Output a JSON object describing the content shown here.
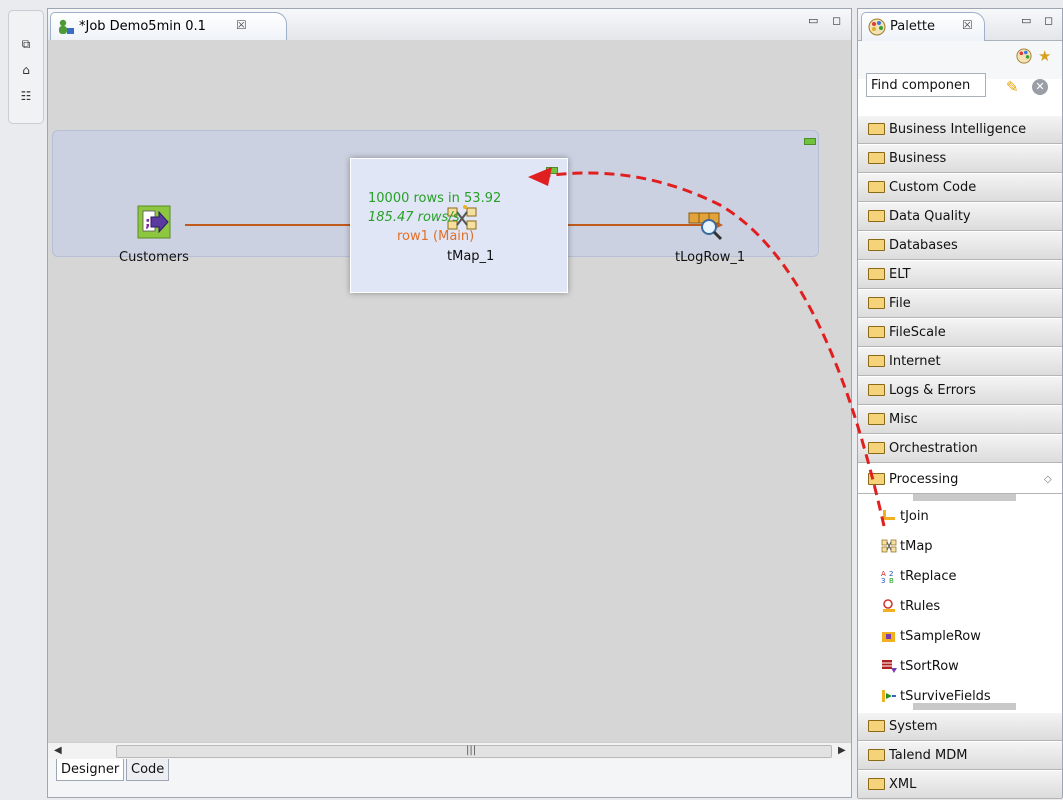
{
  "editor": {
    "tab_title": "*Job Demo5min 0.1",
    "tab_close": "☒"
  },
  "bottom_tabs": [
    "Designer",
    "Code"
  ],
  "canvas": {
    "components": {
      "customers": "Customers",
      "tmap": "tMap_1",
      "logrow": "tLogRow_1"
    },
    "flow_stats": {
      "rows": "10000 rows in 53.92",
      "rate": "185.47 rows/s",
      "link": "row1 (Main)"
    }
  },
  "palette": {
    "tab_title": "Palette",
    "tab_close": "☒",
    "find_placeholder": "Find componen",
    "categories_before": [
      "Business Intelligence",
      "Business",
      "Custom Code",
      "Data Quality",
      "Databases",
      "ELT",
      "File",
      "FileScale",
      "Internet",
      "Logs & Errors",
      "Misc",
      "Orchestration"
    ],
    "open_category": "Processing",
    "components": [
      "tJoin",
      "tMap",
      "tReplace",
      "tRules",
      "tSampleRow",
      "tSortRow",
      "tSurviveFields"
    ],
    "categories_after": [
      "System",
      "Talend MDM",
      "XML"
    ]
  },
  "colors": {
    "drag_arrow": "#e02020",
    "stats_green": "#28a028",
    "link_orange": "#e0702a",
    "subjob_bg": "#ccd1e1"
  }
}
